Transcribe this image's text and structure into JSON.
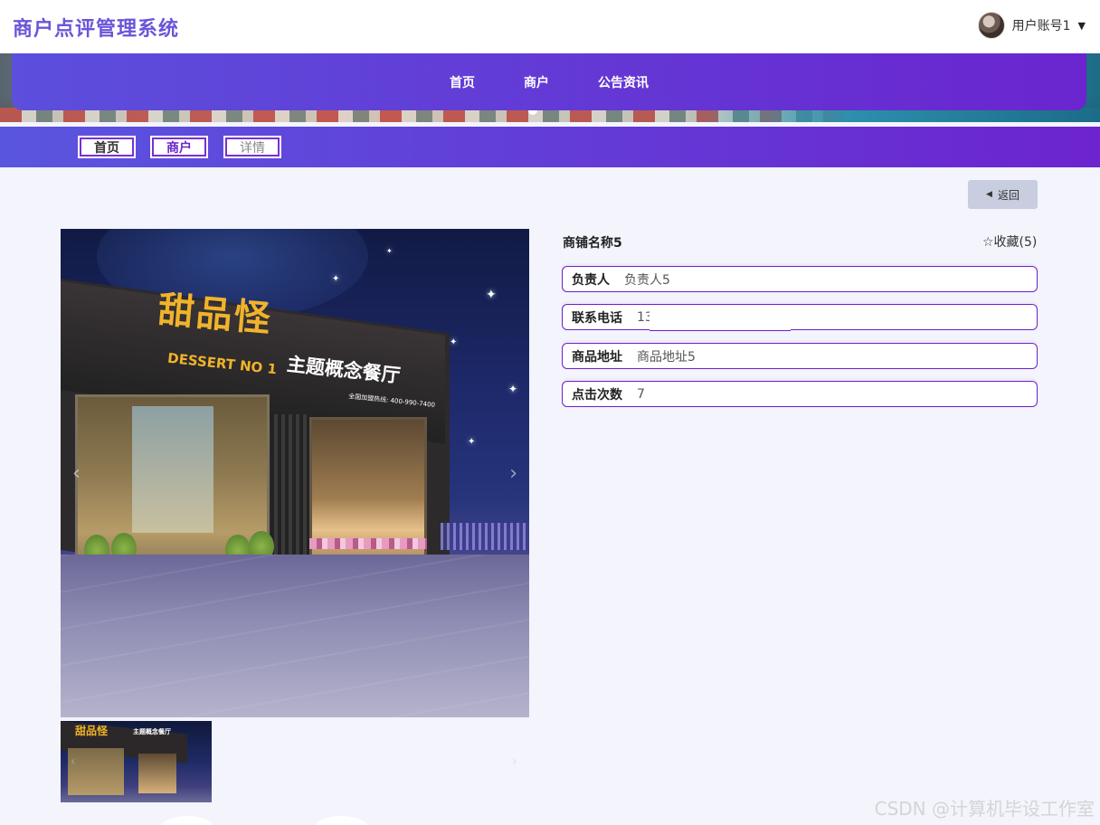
{
  "header": {
    "app_title": "商户点评管理系统",
    "user_name": "用户账号1",
    "caret": "▼"
  },
  "nav": {
    "items": [
      {
        "label": "首页"
      },
      {
        "label": "商户"
      },
      {
        "label": "公告资讯"
      }
    ]
  },
  "breadcrumb": {
    "items": [
      {
        "label": "首页"
      },
      {
        "label": "商户"
      },
      {
        "label": "详情"
      }
    ]
  },
  "actions": {
    "back_label": "返回",
    "back_icon": "◀"
  },
  "gallery": {
    "main_image": {
      "sign_logo": "甜品怪",
      "sign_sub": "DESSERT NO 1",
      "sign_text": "主题概念餐厅",
      "sign_small": "全国加盟热线: 400-990-7400"
    },
    "thumb": {
      "sign_logo": "甜品怪",
      "sign_text": "主题概念餐厅"
    },
    "prev_icon": "‹",
    "next_icon": "›"
  },
  "shop": {
    "name": "商铺名称5",
    "favorite_label": "☆收藏(5)",
    "fields": [
      {
        "label": "负责人",
        "value": "负责人5"
      },
      {
        "label": "联系电话",
        "value": "13"
      },
      {
        "label": "商品地址",
        "value": "商品地址5"
      },
      {
        "label": "点击次数",
        "value": "7"
      }
    ]
  },
  "watermark": "CSDN @计算机毕设工作室"
}
